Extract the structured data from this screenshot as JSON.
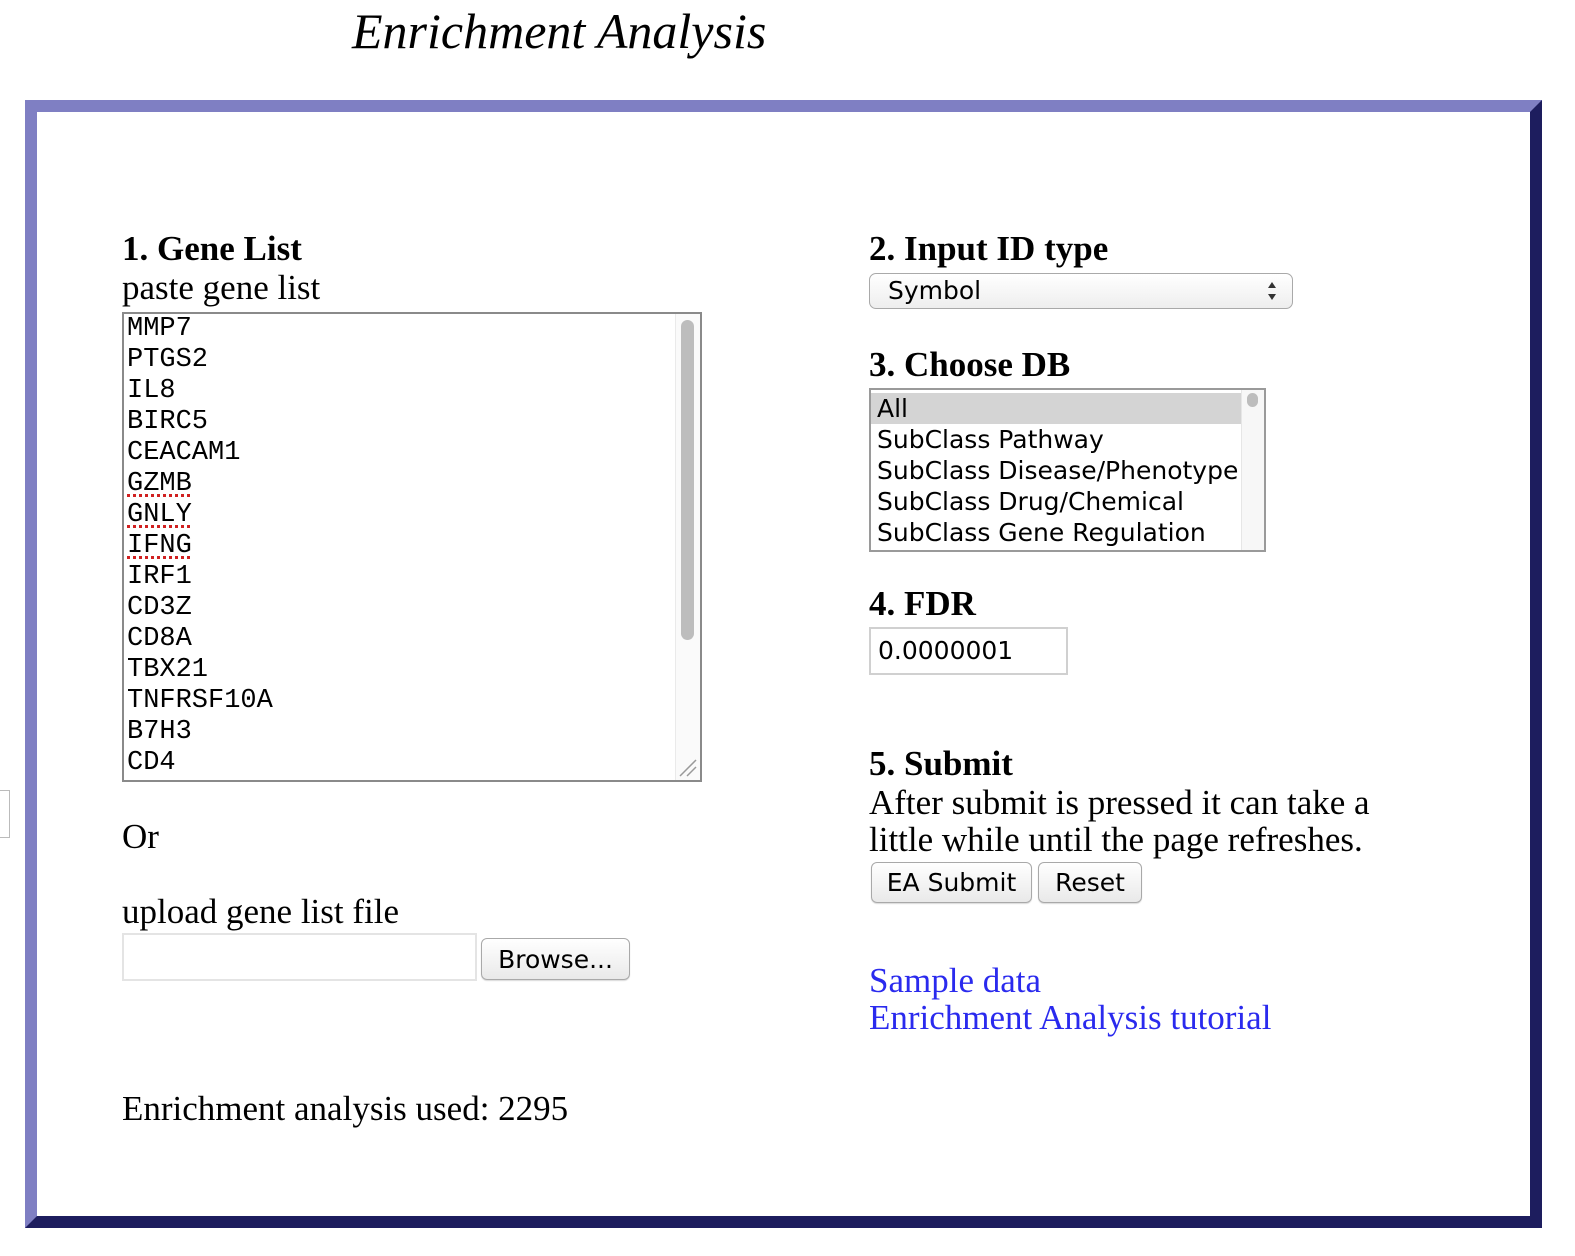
{
  "title": "Enrichment Analysis",
  "gene_list": {
    "heading": "1. Gene List",
    "paste_label": "paste gene list",
    "genes": [
      {
        "name": "MMP7",
        "misspelled": false
      },
      {
        "name": "PTGS2",
        "misspelled": false
      },
      {
        "name": "IL8",
        "misspelled": false
      },
      {
        "name": "BIRC5",
        "misspelled": false
      },
      {
        "name": "CEACAM1",
        "misspelled": false
      },
      {
        "name": "GZMB",
        "misspelled": true
      },
      {
        "name": "GNLY",
        "misspelled": true
      },
      {
        "name": "IFNG",
        "misspelled": true
      },
      {
        "name": "IRF1",
        "misspelled": false
      },
      {
        "name": "CD3Z",
        "misspelled": false
      },
      {
        "name": "CD8A",
        "misspelled": false
      },
      {
        "name": "TBX21",
        "misspelled": false
      },
      {
        "name": "TNFRSF10A",
        "misspelled": false
      },
      {
        "name": "B7H3",
        "misspelled": false
      },
      {
        "name": "CD4",
        "misspelled": false
      }
    ],
    "or_label": "Or",
    "upload_label": "upload gene list file",
    "file_value": "",
    "browse_label": "Browse..."
  },
  "usage_text": "Enrichment analysis used: 2295",
  "input_id_type": {
    "heading": "2. Input ID type",
    "selected": "Symbol"
  },
  "choose_db": {
    "heading": "3. Choose DB",
    "options": [
      {
        "label": "All",
        "selected": true
      },
      {
        "label": "SubClass Pathway",
        "selected": false
      },
      {
        "label": "SubClass Disease/Phenotype",
        "selected": false
      },
      {
        "label": "SubClass Drug/Chemical",
        "selected": false
      },
      {
        "label": "SubClass Gene Regulation",
        "selected": false
      }
    ]
  },
  "fdr": {
    "heading": "4. FDR",
    "value": "0.0000001"
  },
  "submit": {
    "heading": "5. Submit",
    "note_line1": "After submit is pressed it can take a",
    "note_line2": "little while until the page refreshes.",
    "submit_label": "EA Submit",
    "reset_label": "Reset"
  },
  "links": {
    "sample_data": "Sample data",
    "tutorial": "Enrichment Analysis tutorial"
  },
  "colors": {
    "frame_light": "#7f7fc3",
    "frame_dark": "#1d1d5e",
    "link": "#2a2aee",
    "selected_option_bg": "#d4d4d4"
  }
}
